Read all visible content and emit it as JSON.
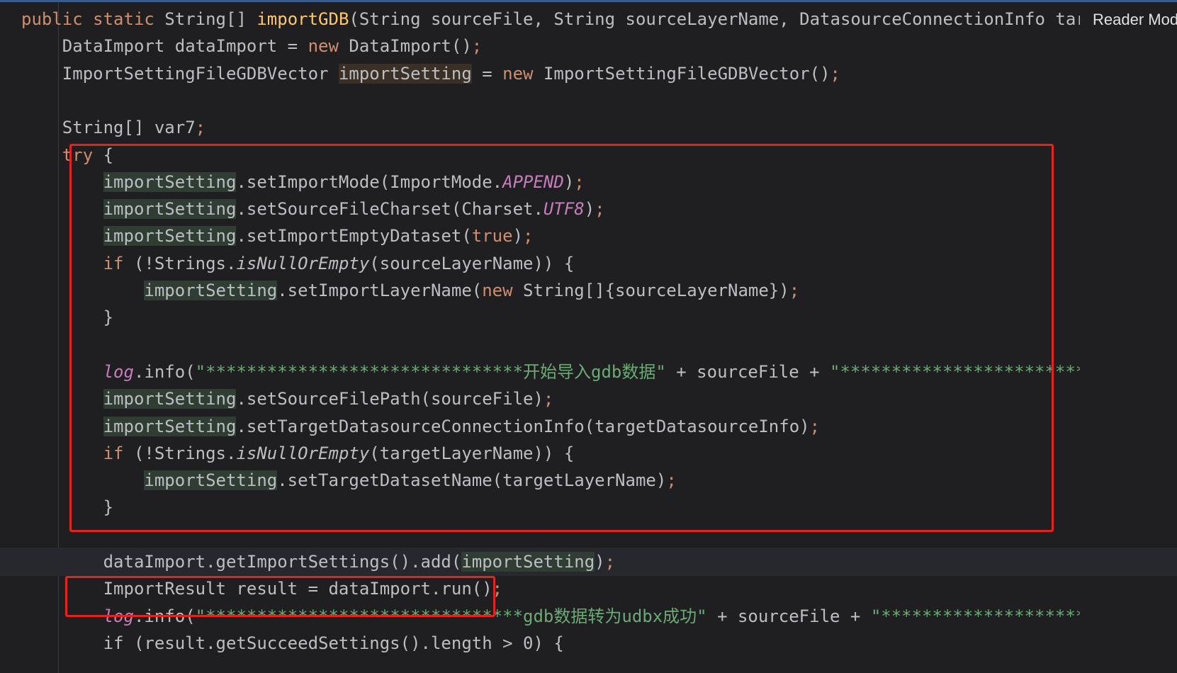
{
  "editor": {
    "reader_mode_label": "Reader Mode",
    "lines": [
      {
        "tokens": [
          {
            "t": "public static ",
            "c": "kw"
          },
          {
            "t": "String[] ",
            "c": "plain"
          },
          {
            "t": "importGDB",
            "c": "decl"
          },
          {
            "t": "(String sourceFile, String sourceLayerName, DatasourceConnectionInfo targ",
            "c": "plain"
          }
        ]
      },
      {
        "tokens": [
          {
            "t": "    DataImport dataImport = ",
            "c": "plain"
          },
          {
            "t": "new ",
            "c": "kw"
          },
          {
            "t": "DataImport()",
            "c": "plain"
          },
          {
            "t": ";",
            "c": "kw"
          }
        ]
      },
      {
        "tokens": [
          {
            "t": "    ImportSettingFileGDBVector ",
            "c": "plain"
          },
          {
            "t": "importSetting",
            "c": "local-hl"
          },
          {
            "t": " = ",
            "c": "plain"
          },
          {
            "t": "new ",
            "c": "kw"
          },
          {
            "t": "ImportSettingFileGDBVector()",
            "c": "plain"
          },
          {
            "t": ";",
            "c": "kw"
          }
        ]
      },
      {
        "tokens": []
      },
      {
        "tokens": [
          {
            "t": "    String[] var7",
            "c": "plain"
          },
          {
            "t": ";",
            "c": "kw"
          }
        ]
      },
      {
        "tokens": [
          {
            "t": "    ",
            "c": "plain"
          },
          {
            "t": "try",
            "c": "kw"
          },
          {
            "t": " {",
            "c": "plain"
          }
        ]
      },
      {
        "tokens": [
          {
            "t": "        ",
            "c": "plain"
          },
          {
            "t": "importSetting",
            "c": "var-hl"
          },
          {
            "t": ".setImportMode(ImportMode.",
            "c": "plain"
          },
          {
            "t": "APPEND",
            "c": "static"
          },
          {
            "t": ")",
            "c": "plain"
          },
          {
            "t": ";",
            "c": "kw"
          }
        ]
      },
      {
        "tokens": [
          {
            "t": "        ",
            "c": "plain"
          },
          {
            "t": "importSetting",
            "c": "var-hl"
          },
          {
            "t": ".setSourceFileCharset(Charset.",
            "c": "plain"
          },
          {
            "t": "UTF8",
            "c": "static"
          },
          {
            "t": ")",
            "c": "plain"
          },
          {
            "t": ";",
            "c": "kw"
          }
        ]
      },
      {
        "tokens": [
          {
            "t": "        ",
            "c": "plain"
          },
          {
            "t": "importSetting",
            "c": "var-hl"
          },
          {
            "t": ".setImportEmptyDataset(",
            "c": "plain"
          },
          {
            "t": "true",
            "c": "kw"
          },
          {
            "t": ")",
            "c": "plain"
          },
          {
            "t": ";",
            "c": "kw"
          }
        ]
      },
      {
        "tokens": [
          {
            "t": "        ",
            "c": "plain"
          },
          {
            "t": "if",
            "c": "kw"
          },
          {
            "t": " (!Strings.",
            "c": "plain"
          },
          {
            "t": "isNullOrEmpty",
            "c": "italic"
          },
          {
            "t": "(sourceLayerName)) {",
            "c": "plain"
          }
        ]
      },
      {
        "tokens": [
          {
            "t": "            ",
            "c": "plain"
          },
          {
            "t": "importSetting",
            "c": "var-hl"
          },
          {
            "t": ".setImportLayerName(",
            "c": "plain"
          },
          {
            "t": "new ",
            "c": "kw"
          },
          {
            "t": "String[]{sourceLayerName})",
            "c": "plain"
          },
          {
            "t": ";",
            "c": "kw"
          }
        ]
      },
      {
        "tokens": [
          {
            "t": "        }",
            "c": "plain"
          }
        ]
      },
      {
        "tokens": []
      },
      {
        "tokens": [
          {
            "t": "        ",
            "c": "plain"
          },
          {
            "t": "log",
            "c": "static"
          },
          {
            "t": ".info(",
            "c": "plain"
          },
          {
            "t": "\"*******************************开始导入gdb数据\"",
            "c": "str"
          },
          {
            "t": " + sourceFile + ",
            "c": "plain"
          },
          {
            "t": "\"***************************\"",
            "c": "str"
          },
          {
            "t": ")",
            "c": "plain"
          },
          {
            "t": ";",
            "c": "kw"
          }
        ]
      },
      {
        "tokens": [
          {
            "t": "        ",
            "c": "plain"
          },
          {
            "t": "importSetting",
            "c": "var-hl"
          },
          {
            "t": ".setSourceFilePath(sourceFile)",
            "c": "plain"
          },
          {
            "t": ";",
            "c": "kw"
          }
        ]
      },
      {
        "tokens": [
          {
            "t": "        ",
            "c": "plain"
          },
          {
            "t": "importSetting",
            "c": "var-hl"
          },
          {
            "t": ".setTargetDatasourceConnectionInfo(targetDatasourceInfo)",
            "c": "plain"
          },
          {
            "t": ";",
            "c": "kw"
          }
        ]
      },
      {
        "tokens": [
          {
            "t": "        ",
            "c": "plain"
          },
          {
            "t": "if",
            "c": "kw"
          },
          {
            "t": " (!Strings.",
            "c": "plain"
          },
          {
            "t": "isNullOrEmpty",
            "c": "italic"
          },
          {
            "t": "(targetLayerName)) {",
            "c": "plain"
          }
        ]
      },
      {
        "tokens": [
          {
            "t": "            ",
            "c": "plain"
          },
          {
            "t": "importSetting",
            "c": "var-hl"
          },
          {
            "t": ".setTargetDatasetName(targetLayerName)",
            "c": "plain"
          },
          {
            "t": ";",
            "c": "kw"
          }
        ]
      },
      {
        "tokens": [
          {
            "t": "        }",
            "c": "plain"
          }
        ]
      },
      {
        "tokens": []
      },
      {
        "current": true,
        "tokens": [
          {
            "t": "        dataImport.getImportSettings().add(",
            "c": "plain"
          },
          {
            "t": "importSetting",
            "c": "var-hl"
          },
          {
            "t": ")",
            "c": "plain"
          },
          {
            "t": ";",
            "c": "kw"
          }
        ]
      },
      {
        "tokens": [
          {
            "t": "        ImportResult result = dataImport.run()",
            "c": "plain"
          },
          {
            "t": ";",
            "c": "kw"
          }
        ]
      },
      {
        "tokens": [
          {
            "t": "        ",
            "c": "plain"
          },
          {
            "t": "log",
            "c": "static"
          },
          {
            "t": ".info(",
            "c": "plain"
          },
          {
            "t": "\"*******************************gdb数据转为udbx成功\"",
            "c": "str"
          },
          {
            "t": " + sourceFile + ",
            "c": "plain"
          },
          {
            "t": "\"***************************\"",
            "c": "str"
          },
          {
            "t": ")",
            "c": "plain"
          },
          {
            "t": ";",
            "c": "kw"
          }
        ]
      },
      {
        "tokens": [
          {
            "t": "        if (result.getSucceedSettings().length > 0) {",
            "c": "plain"
          }
        ]
      }
    ]
  }
}
